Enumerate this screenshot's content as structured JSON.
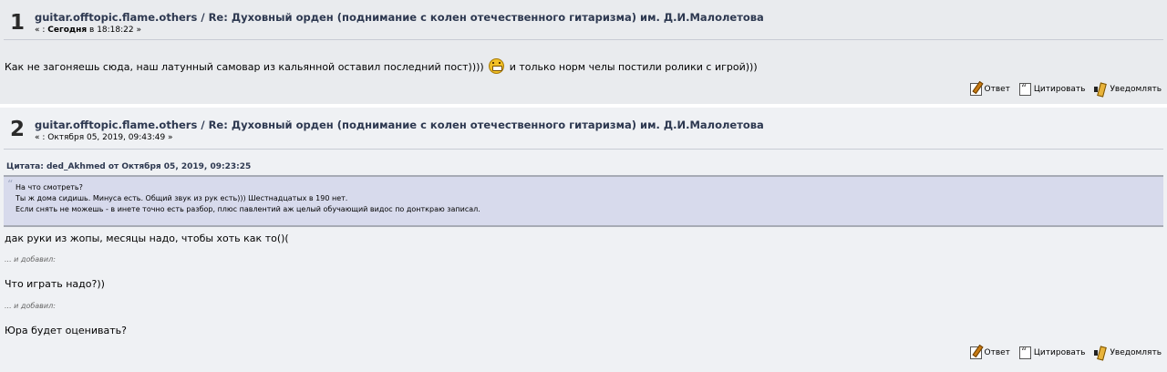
{
  "posts": [
    {
      "number": "1",
      "board": "guitar.offtopic.flame.others",
      "separator": "/",
      "subject": "Re: Духовный орден (поднимание с колен отечественного гитаризма) им. Д.И.Малолетова",
      "date_prefix": "« :",
      "date_bold": "Сегодня",
      "date_rest": "в 18:18:22 »",
      "text_before_smiley": "Как не загоняешь сюда, наш латунный самовар из кальянной оставил последний пост))))",
      "text_after_smiley": "и только норм челы постили ролики с игрой)))",
      "smiley_icon": "grin-smiley-icon"
    },
    {
      "number": "2",
      "board": "guitar.offtopic.flame.others",
      "separator": "/",
      "subject": "Re: Духовный орден (поднимание с колен отечественного гитаризма) им. Д.И.Малолетова",
      "date": "« : Октября 05, 2019, 09:43:49 »",
      "quote_header": "Цитата: ded_Akhmed от Октября 05, 2019, 09:23:25",
      "quote_lines": [
        "На что смотреть?",
        "Ты ж дома сидишь. Минуса есть. Общий звук из рук есть))) Шестнадцатых в 190 нет.",
        "Если снять не можешь - в инете точно есть разбор, плюс павлентий аж целый обучающий видос по донткраю записал."
      ],
      "body": "дак руки из жопы, месяцы надо, чтобы хоть как то()(",
      "added_label": "... и добавил:",
      "addition_1": "Что играть надо?))",
      "addition_2": "Юра будет оценивать?"
    }
  ],
  "actions": {
    "reply": "Ответ",
    "quote": "Цитировать",
    "notify": "Уведомлять"
  }
}
